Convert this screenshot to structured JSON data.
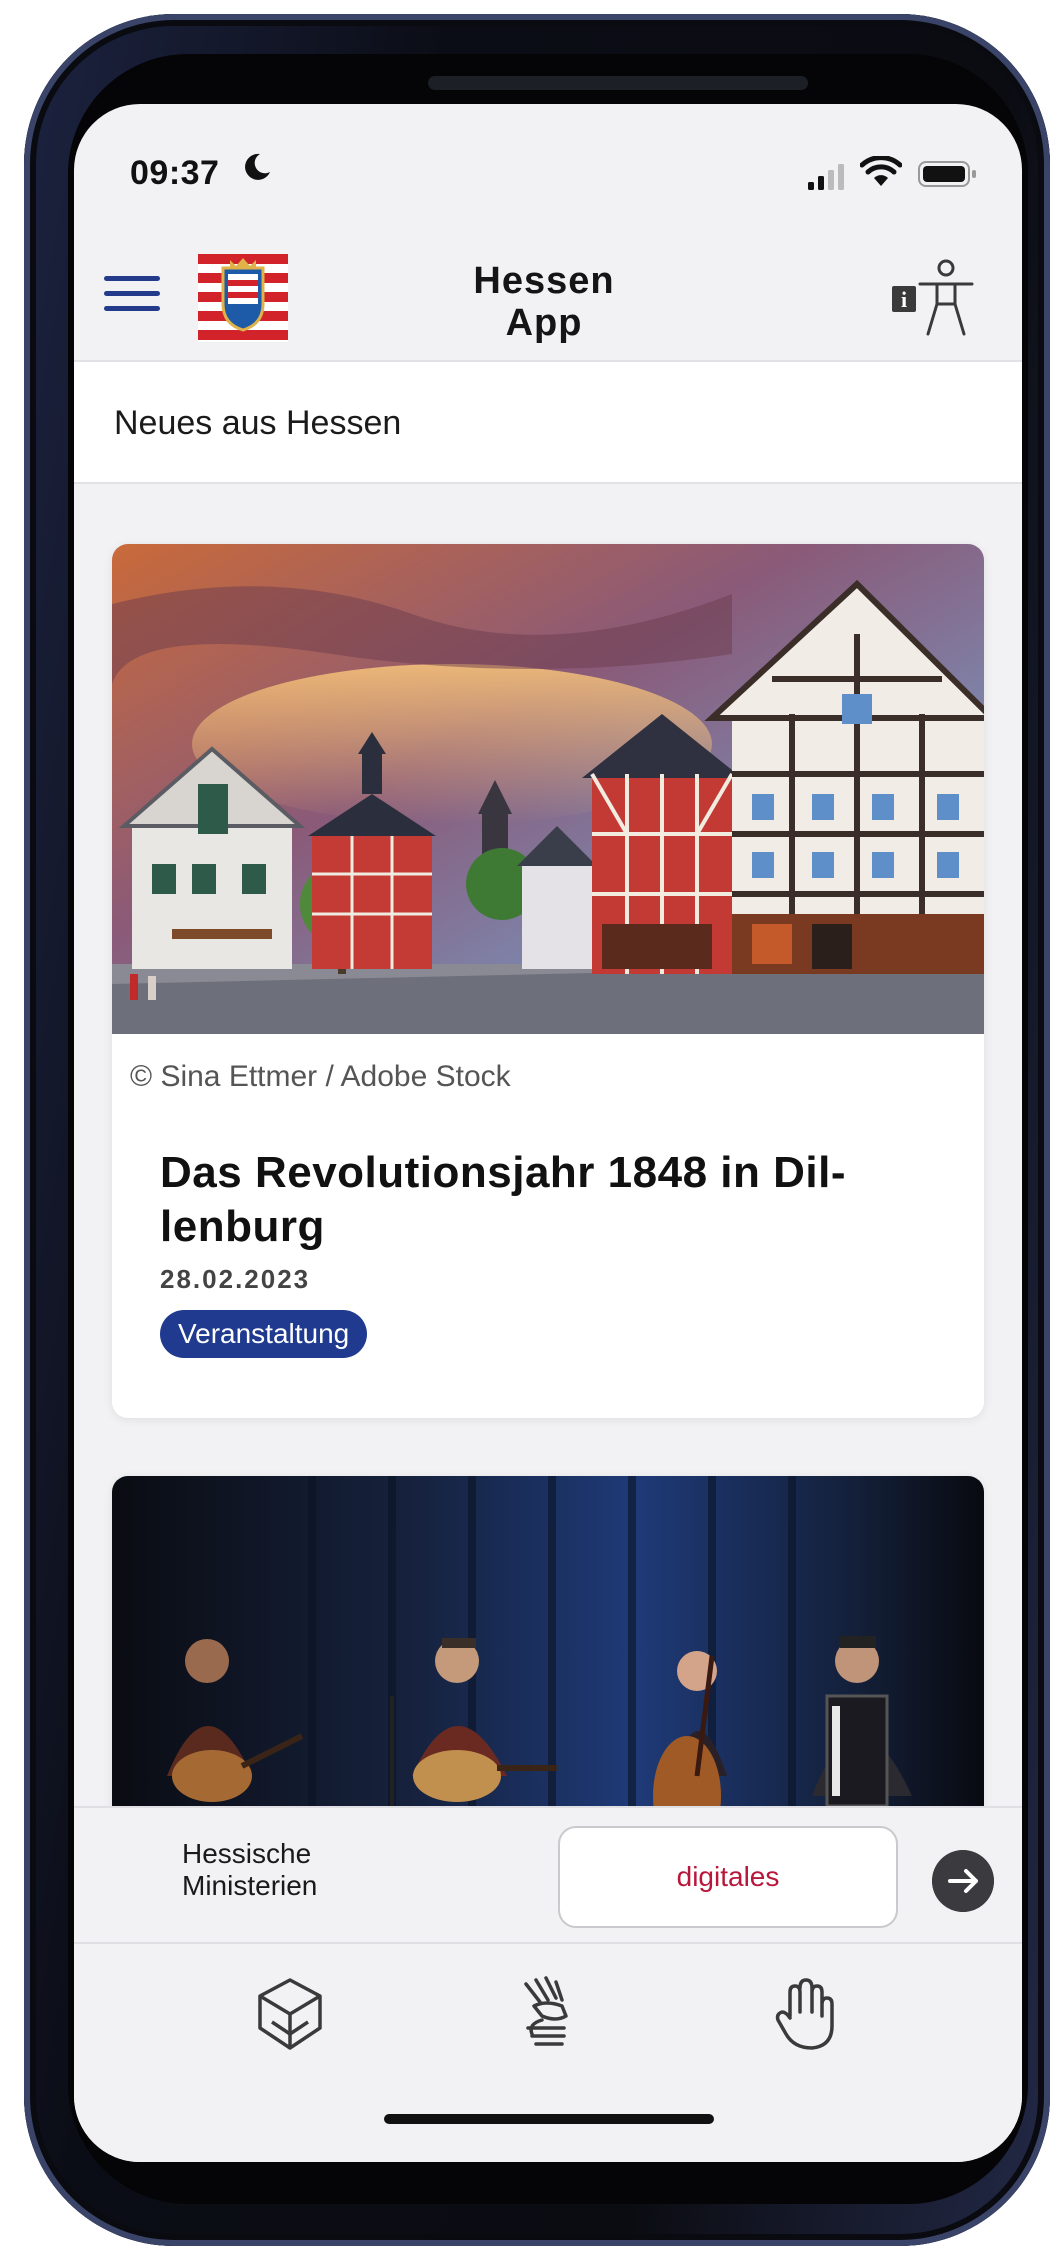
{
  "status_bar": {
    "time": "09:37",
    "icons": [
      "moon-icon",
      "signal-icon",
      "wifi-icon",
      "battery-icon"
    ]
  },
  "header": {
    "title_line1": "Hessen",
    "title_line2": "App",
    "menu_icon": "hamburger-menu-icon",
    "logo": "hessen-coat-of-arms-logo",
    "accessibility_icon": "accessibility-info-icon"
  },
  "section": {
    "title": "Neues aus Hessen"
  },
  "cards": [
    {
      "image": "half-timbered-town-square-photo",
      "credit": "© Sina Ettmer / Adobe Stock",
      "title": "Das Revolutionsjahr 1848 in Dil-lenburg",
      "date": "28.02.2023",
      "tag": "Veranstaltung"
    },
    {
      "image": "folk-band-on-stage-photo"
    }
  ],
  "link_bar": {
    "left_label_line1": "Hessische",
    "left_label_line2": "Ministerien",
    "button_label": "digitales",
    "arrow_icon": "arrow-right-circle-icon"
  },
  "nav": {
    "items": [
      "book-heart-icon",
      "sign-language-icon",
      "hand-icon"
    ]
  },
  "colors": {
    "accent_blue": "#1f3a8f",
    "digital_red": "#b8173b",
    "background": "#f2f2f4"
  }
}
